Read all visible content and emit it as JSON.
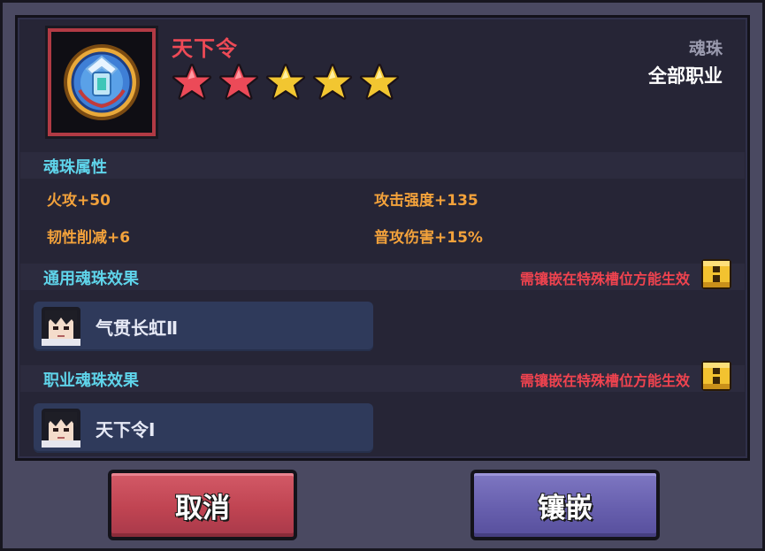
{
  "item": {
    "name": "天下令",
    "stars_total": 5,
    "stars_red": 2,
    "type": "魂珠",
    "class_req": "全部职业"
  },
  "attributes": {
    "title": "魂珠属性",
    "items": [
      "火攻+50",
      "攻击强度+135",
      "韧性削减+6",
      "普攻伤害+15%"
    ]
  },
  "common_effect": {
    "title": "通用魂珠效果",
    "note": "需镶嵌在特殊槽位方能生效",
    "effect_name": "气贯长虹Ⅱ"
  },
  "class_effect": {
    "title": "职业魂珠效果",
    "note": "需镶嵌在特殊槽位方能生效",
    "effect_name": "天下令Ⅰ"
  },
  "buttons": {
    "cancel": "取消",
    "inlay": "镶嵌"
  },
  "colors": {
    "name_red": "#ee4a56",
    "section_cyan": "#5fd4ea",
    "attr_orange": "#f3a23b",
    "note_red": "#f0434f"
  }
}
